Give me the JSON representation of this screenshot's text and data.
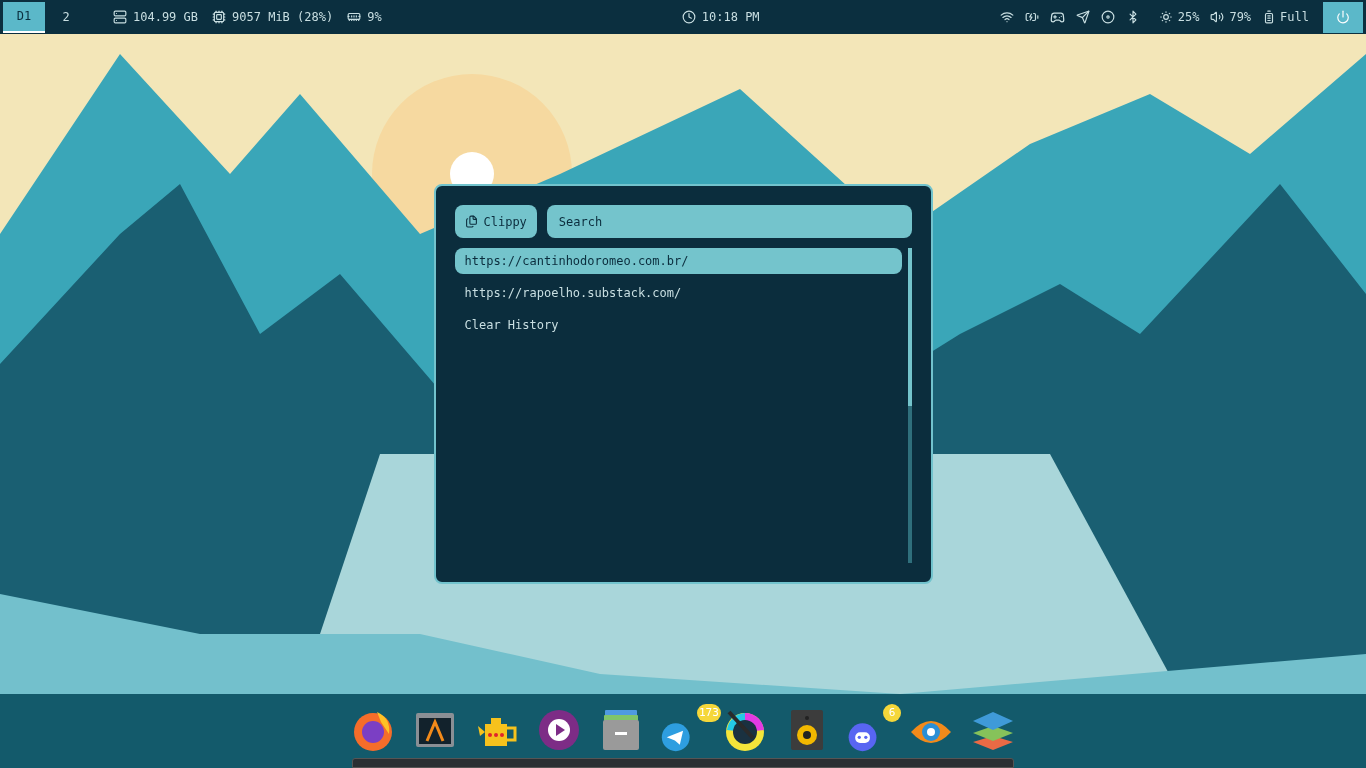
{
  "top_bar": {
    "workspaces": [
      {
        "label": "D1",
        "selected": true
      },
      {
        "label": "2",
        "selected": false
      }
    ],
    "stats": [
      {
        "kind": "disk",
        "text": "104.99 GB"
      },
      {
        "kind": "cpu",
        "text": "9057 MiB (28%)"
      },
      {
        "kind": "memory",
        "text": "9%"
      }
    ],
    "clock": "10:18 PM",
    "brightness": "25%",
    "volume": "79%",
    "battery": "Full"
  },
  "launcher": {
    "title": "Clippy",
    "search": {
      "placeholder": "Search"
    },
    "items": [
      {
        "text": "https://cantinhodoromeo.com.br/",
        "selected": true
      },
      {
        "text": "https://rapoelho.substack.com/",
        "selected": false
      },
      {
        "text": "Clear History",
        "selected": false
      }
    ]
  },
  "dock": [
    {
      "kind": "globe"
    },
    {
      "kind": "terminal"
    },
    {
      "kind": "teapot"
    },
    {
      "kind": "play"
    },
    {
      "kind": "archive"
    },
    {
      "kind": "plane",
      "badge": "173"
    },
    {
      "kind": "brush"
    },
    {
      "kind": "speaker"
    },
    {
      "kind": "chat",
      "badge": "6"
    },
    {
      "kind": "eye"
    },
    {
      "kind": "layers"
    }
  ]
}
